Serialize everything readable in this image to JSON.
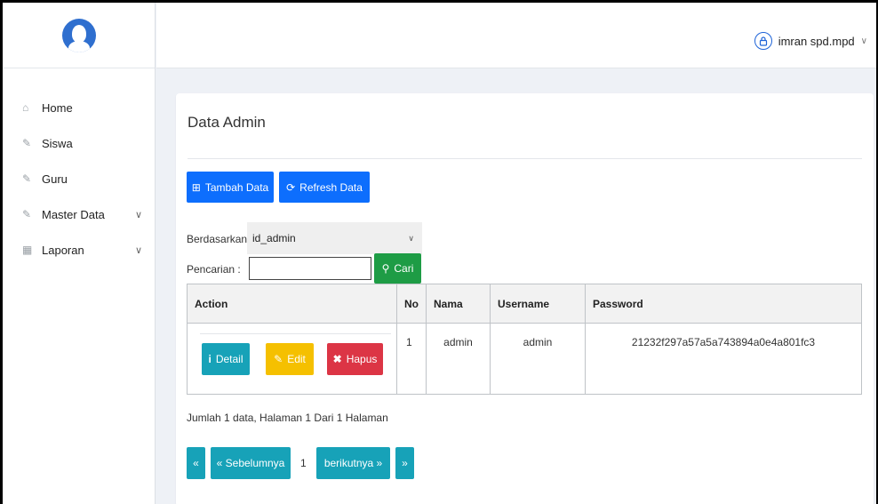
{
  "user": {
    "name": "imran spd.mpd"
  },
  "sidebar": {
    "items": [
      {
        "label": "Home",
        "icon": "home-icon"
      },
      {
        "label": "Siswa",
        "icon": "edit-icon"
      },
      {
        "label": "Guru",
        "icon": "edit-icon"
      },
      {
        "label": "Master Data",
        "icon": "edit-icon",
        "has_submenu": true
      },
      {
        "label": "Laporan",
        "icon": "calendar-icon",
        "has_submenu": true
      }
    ]
  },
  "page": {
    "title": "Data Admin",
    "buttons": {
      "add_label": "Tambah Data",
      "refresh_label": "Refresh Data"
    },
    "filter": {
      "label": "Berdasarkan:",
      "selected": "id_admin"
    },
    "search": {
      "label": "Pencarian :",
      "value": "",
      "button_label": "Cari"
    },
    "table": {
      "headers": [
        "Action",
        "No",
        "Nama",
        "Username",
        "Password"
      ],
      "rows": [
        {
          "no": "1",
          "nama": "admin",
          "username": "admin",
          "password": "21232f297a57a5a743894a0e4a801fc3"
        }
      ],
      "actions": {
        "detail": "Detail",
        "edit": "Edit",
        "hapus": "Hapus"
      }
    },
    "summary": "Jumlah 1 data, Halaman 1 Dari 1 Halaman",
    "pagination": {
      "first": "«",
      "prev": "« Sebelumnya",
      "current": "1",
      "next": "berikutnya »",
      "last": "»"
    }
  },
  "colors": {
    "primary": "#0d6efd",
    "success": "#1e9c45",
    "info": "#17a2b8",
    "warning": "#f5c000",
    "danger": "#dc3545"
  }
}
